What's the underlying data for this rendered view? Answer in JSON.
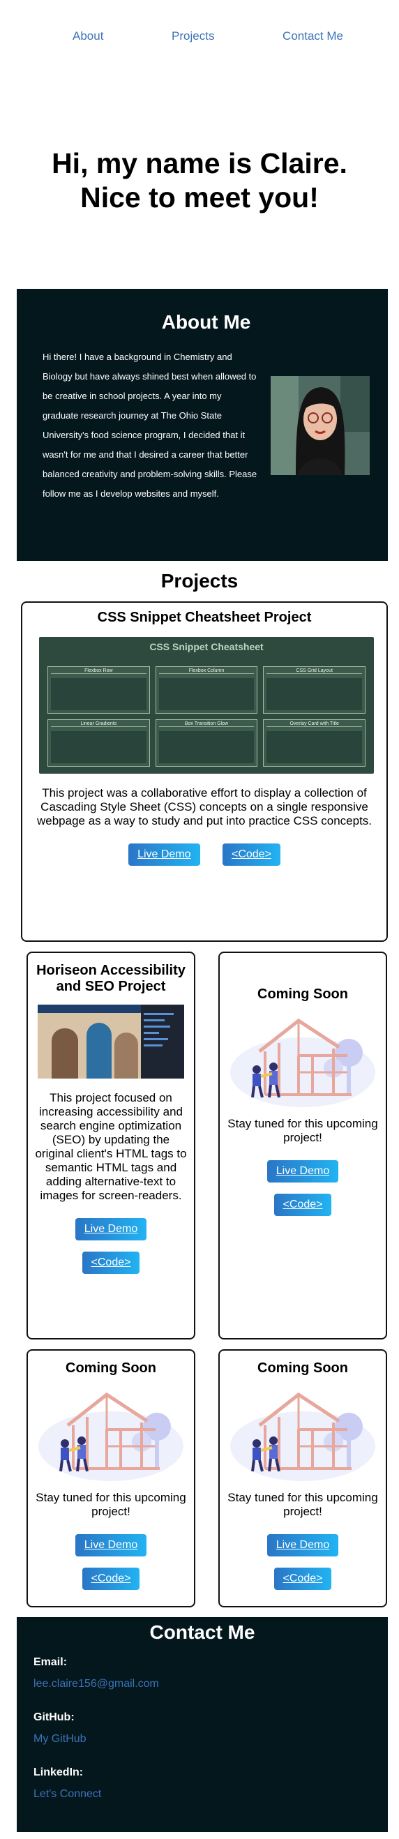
{
  "nav": {
    "about": "About",
    "projects": "Projects",
    "contact": "Contact Me"
  },
  "hero": {
    "line1": "Hi, my name is Claire.",
    "line2": "Nice to meet you!"
  },
  "about": {
    "title": "About Me",
    "text": "Hi there! I have a background in Chemistry and Biology but have always shined best when allowed to be creative in school projects. A year into my graduate research journey at The Ohio State University's food science program, I decided that it wasn't for me and that I desired a career that better balanced creativity and problem-solving skills. Please follow me as I develop websites and myself."
  },
  "projects": {
    "title": "Projects",
    "featured": {
      "title": "CSS Snippet Cheatsheet Project",
      "description": "This project was a collaborative effort to display a collection of Cascading Style Sheet (CSS) concepts on a single responsive webpage as a way to study and put into practice CSS concepts.",
      "demo": "Live Demo",
      "code": "<Code>",
      "screenshot": {
        "title": "CSS Snippet Cheatsheet",
        "tiles": [
          "Flexbox Row",
          "Flexbox Column",
          "CSS Grid Layout",
          "Linear Gradients",
          "Box Transition Glow",
          "Overlay Card with Title"
        ]
      }
    },
    "seo": {
      "title": "Horiseon Accessibility and SEO Project",
      "description": "This project focused on increasing accessibility and search engine optimization (SEO) by updating the original client's HTML tags to semantic HTML tags and adding alternative-text to images for screen-readers.",
      "demo": "Live Demo",
      "code": "<Code>"
    },
    "coming": {
      "title": "Coming Soon",
      "text": "Stay tuned for this upcoming project!",
      "demo": "Live Demo",
      "code": "<Code>"
    }
  },
  "contact": {
    "title": "Contact Me",
    "email_label": "Email:",
    "email": "lee.claire156@gmail.com",
    "github_label": "GitHub:",
    "github": "My GitHub",
    "linkedin_label": "LinkedIn:",
    "linkedin": "Let's Connect"
  }
}
